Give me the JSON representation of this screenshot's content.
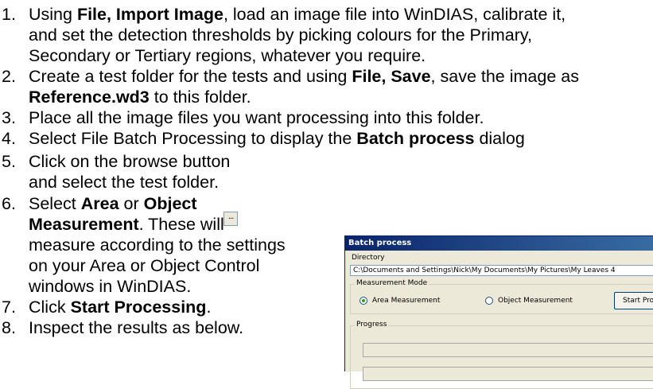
{
  "steps": [
    {
      "num": "1.",
      "lines": [
        [
          {
            "t": "Using "
          },
          {
            "t": "File, Import Image",
            "b": true
          },
          {
            "t": ", load an image file into WinDIAS, calibrate it,"
          }
        ],
        [
          {
            "t": "and set the detection thresholds by picking colours for the Primary,"
          }
        ],
        [
          {
            "t": "Secondary or Tertiary regions, whatever you require."
          }
        ]
      ]
    },
    {
      "num": "2.",
      "lines": [
        [
          {
            "t": "Create a test folder for the tests and using "
          },
          {
            "t": "File, Save",
            "b": true
          },
          {
            "t": ", save the image as"
          }
        ],
        [
          {
            "t": "Reference.wd3",
            "b": true
          },
          {
            "t": " to this folder."
          }
        ]
      ]
    },
    {
      "num": "3.",
      "lines": [
        [
          {
            "t": "Place all the image files you want processing into this folder."
          }
        ]
      ]
    },
    {
      "num": "4.",
      "lines": [
        [
          {
            "t": "Select File Batch Processing to display the "
          },
          {
            "t": "Batch process",
            "b": true
          },
          {
            "t": " dialog"
          }
        ]
      ]
    },
    {
      "num": "5.",
      "lines": [
        [
          {
            "t": "Click on the browse button"
          }
        ],
        [
          {
            "t": "and select the test folder."
          }
        ]
      ]
    },
    {
      "num": "6.",
      "lines": [
        [
          {
            "t": "Select "
          },
          {
            "t": "Area",
            "b": true
          },
          {
            "t": " or "
          },
          {
            "t": "Object",
            "b": true
          }
        ],
        [
          {
            "t": "Measurement",
            "b": true
          },
          {
            "t": ". These will"
          }
        ],
        [
          {
            "t": "measure according to the settings"
          }
        ],
        [
          {
            "t": "on your Area or Object Control"
          }
        ],
        [
          {
            "t": "windows in WinDIAS."
          }
        ]
      ]
    },
    {
      "num": "7.",
      "lines": [
        [
          {
            "t": "Click "
          },
          {
            "t": "Start Processing",
            "b": true
          },
          {
            "t": "."
          }
        ]
      ]
    },
    {
      "num": "8.",
      "lines": [
        [
          {
            "t": "Inspect the results as below."
          }
        ]
      ]
    }
  ],
  "browse_button": {
    "label": "..."
  },
  "dialog": {
    "title": "Batch process",
    "directory_label": "Directory",
    "directory_value": "C:\\Documents and Settings\\Nick\\My Documents\\My Pictures\\My Leaves 4",
    "mode_group_label": "Measurement Mode",
    "area_label": "Area Measurement",
    "object_label": "Object Measurement",
    "selected_mode": "area",
    "start_button_label": "Start Processing",
    "progress_group_label": "Progress"
  }
}
